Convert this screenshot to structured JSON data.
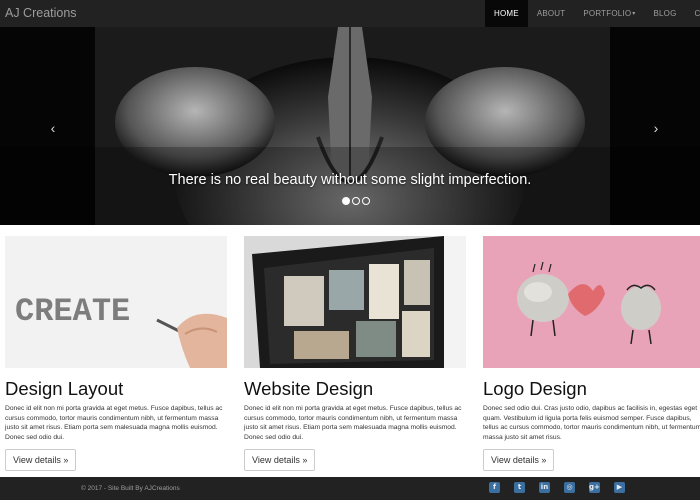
{
  "navbar": {
    "brand": "AJ Creations",
    "items": [
      {
        "label": "HOME",
        "active": true
      },
      {
        "label": "ABOUT",
        "active": false
      },
      {
        "label": "PORTFOLIO",
        "active": false,
        "dropdown": true
      },
      {
        "label": "BLOG",
        "active": false
      },
      {
        "label": "CONTACT",
        "active": false
      }
    ]
  },
  "carousel": {
    "caption": "There is no real beauty without some slight imperfection.",
    "prev_icon": "chevron-left-icon",
    "next_icon": "chevron-right-icon",
    "slide_count": 3,
    "active_slide": 1
  },
  "features": [
    {
      "image": "create-handwriting-photo",
      "image_text": "CREATE",
      "title": "Design Layout",
      "text": "Donec id elit non mi porta gravida at eget metus. Fusce dapibus, tellus ac cursus commodo, tortor mauris condimentum nibh, ut fermentum massa justo sit amet risus. Etiam porta sem malesuada magna mollis euismod. Donec sed odio dui.",
      "button": "View details »"
    },
    {
      "image": "monitor-website-photo",
      "title": "Website Design",
      "text": "Donec id elit non mi porta gravida at eget metus. Fusce dapibus, tellus ac cursus commodo, tortor mauris condimentum nibh, ut fermentum massa justo sit amet risus. Etiam porta sem malesuada magna mollis euismod. Donec sed odio dui.",
      "button": "View details »"
    },
    {
      "image": "stones-heart-photo",
      "title": "Logo Design",
      "text": "Donec sed odio dui. Cras justo odio, dapibus ac facilisis in, egestas eget quam. Vestibulum id ligula porta felis euismod semper. Fusce dapibus, tellus ac cursus commodo, tortor mauris condimentum nibh, ut fermentum massa justo sit amet risus.",
      "button": "View details »"
    }
  ],
  "footer": {
    "copyright": "© 2017 - Site Built By AJCreations",
    "social": [
      {
        "name": "facebook-icon",
        "glyph": "f"
      },
      {
        "name": "twitter-icon",
        "glyph": "t"
      },
      {
        "name": "linkedin-icon",
        "glyph": "in"
      },
      {
        "name": "instagram-icon",
        "glyph": "◎"
      },
      {
        "name": "google-plus-icon",
        "glyph": "g+"
      },
      {
        "name": "youtube-icon",
        "glyph": "▶"
      }
    ]
  },
  "colors": {
    "navbar_bg": "#222222",
    "nav_active_bg": "#080808",
    "nav_text": "#9d9d9d",
    "social_icon": "#3b6fa0",
    "logo_bg": "#e8a3b8"
  }
}
